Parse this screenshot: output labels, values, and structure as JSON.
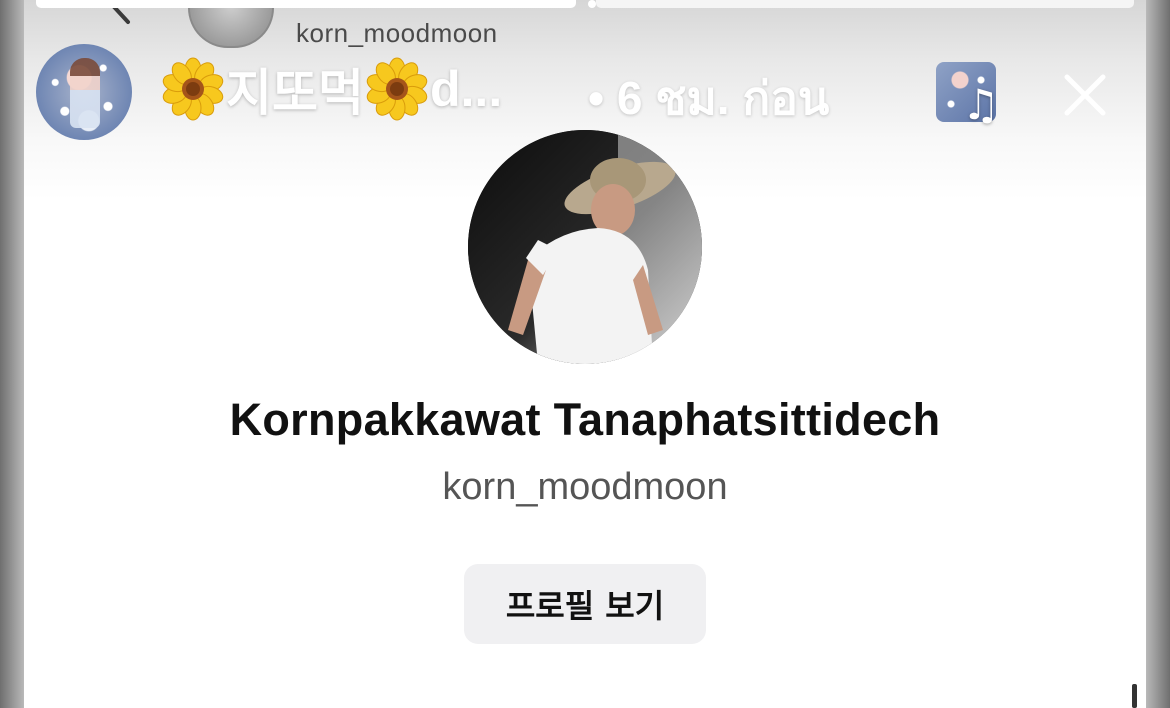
{
  "background_layer": {
    "username": "korn_moodmoon"
  },
  "story_header": {
    "title": "지또먹",
    "title_suffix": "d...",
    "time": "• 6 ชม. ก่อน",
    "music_note": "♫"
  },
  "profile_card": {
    "name": "Kornpakkawat Tanaphatsittidech",
    "username": "korn_moodmoon",
    "view_profile_label": "프로필 보기"
  },
  "colors": {
    "flower_petal": "#f7c81e",
    "flower_center": "#a5551a",
    "header_text": "#ffffff",
    "button_bg": "#f0f0f2"
  }
}
